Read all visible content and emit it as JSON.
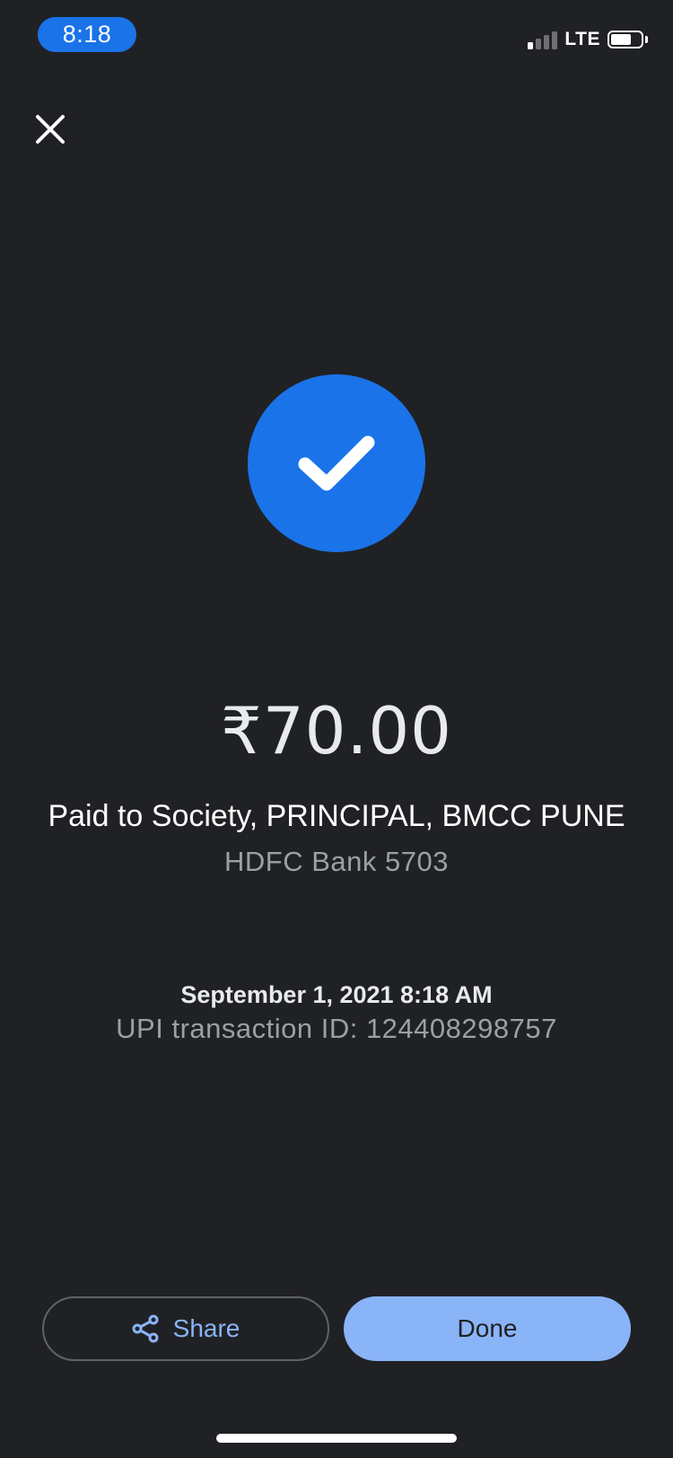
{
  "status_bar": {
    "time": "8:18",
    "network": "LTE",
    "signal_bars_active": 1,
    "signal_bars_total": 4,
    "battery_level": 0.7
  },
  "icons": {
    "close": "close-icon",
    "success": "check-icon",
    "share": "share-icon"
  },
  "colors": {
    "background": "#202124",
    "accent": "#1a73e8",
    "button_primary": "#8ab4f8",
    "secondary_text": "#9aa0a6"
  },
  "payment": {
    "amount": "₹70.00",
    "paid_to": "Paid to Society, PRINCIPAL, BMCC PUNE",
    "bank": "HDFC Bank 5703",
    "datetime": "September 1, 2021 8:18 AM",
    "transaction_id": "UPI transaction ID: 124408298757"
  },
  "actions": {
    "share_label": "Share",
    "done_label": "Done"
  }
}
